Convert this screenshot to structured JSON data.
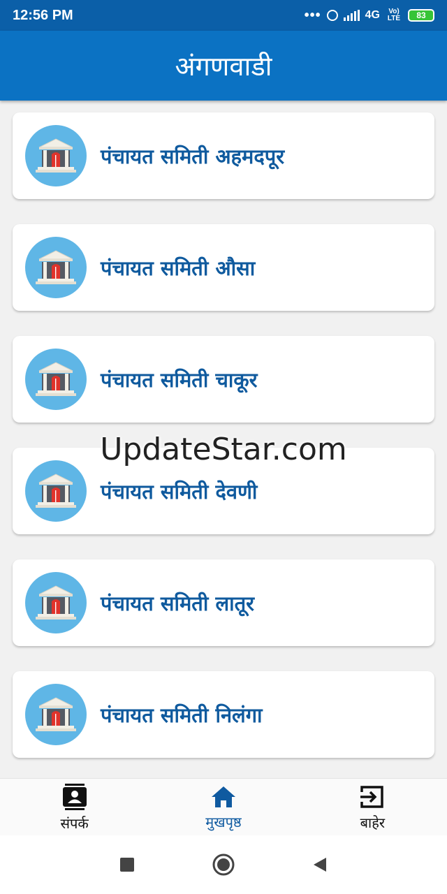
{
  "status_bar": {
    "time": "12:56 PM",
    "network": "4G",
    "volte": "Vo) LTE",
    "battery": "83"
  },
  "app_bar": {
    "title": "अंगणवाडी"
  },
  "list": {
    "items": [
      {
        "label": "पंचायत समिती अहमदपूर",
        "icon": "building-icon"
      },
      {
        "label": "पंचायत समिती औसा",
        "icon": "building-icon"
      },
      {
        "label": "पंचायत समिती चाकूर",
        "icon": "building-icon"
      },
      {
        "label": "पंचायत समिती देवणी",
        "icon": "building-icon"
      },
      {
        "label": "पंचायत समिती लातूर",
        "icon": "building-icon"
      },
      {
        "label": "पंचायत समिती निलंगा",
        "icon": "building-icon"
      }
    ]
  },
  "watermark": "UpdateStar.com",
  "bottom_nav": {
    "items": [
      {
        "label": "संपर्क",
        "icon": "contact-icon",
        "active": false
      },
      {
        "label": "मुखपृष्ठ",
        "icon": "home-icon",
        "active": true
      },
      {
        "label": "बाहेर",
        "icon": "exit-icon",
        "active": false
      }
    ]
  },
  "colors": {
    "status_bar": "#0b5fa8",
    "app_bar": "#0b72c3",
    "card_text": "#0f5a9e",
    "icon_circle": "#5fb6e6",
    "nav_active": "#0f5aa0"
  }
}
